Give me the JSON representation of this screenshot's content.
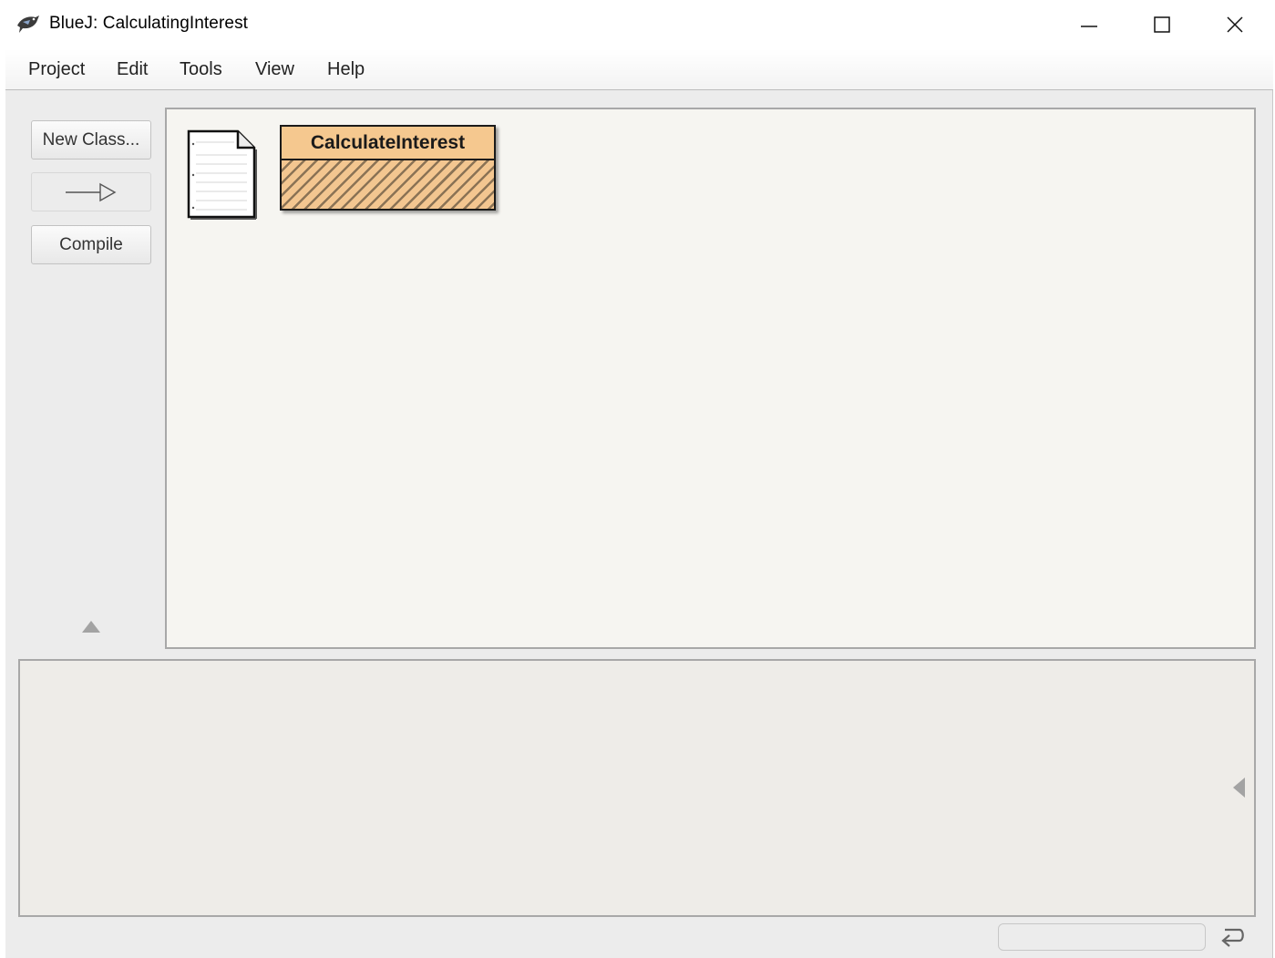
{
  "window": {
    "title": "BlueJ:  CalculatingInterest",
    "icons": {
      "app": "bluej-bird-icon",
      "minimize": "minimize-icon",
      "maximize": "maximize-icon",
      "close": "close-icon"
    }
  },
  "menu": {
    "items": [
      {
        "label": "Project"
      },
      {
        "label": "Edit"
      },
      {
        "label": "Tools"
      },
      {
        "label": "View"
      },
      {
        "label": "Help"
      }
    ]
  },
  "toolbar": {
    "new_class_label": "New Class...",
    "inheritance_arrow_icon": "inheritance-arrow-icon",
    "compile_label": "Compile",
    "collapse_icon": "triangle-up-icon"
  },
  "diagram": {
    "readme_icon": "readme-document-icon",
    "class_name": "CalculateInterest",
    "class_state": "uncompiled",
    "colors": {
      "class_fill": "#f5c88f",
      "stripe": "#8b7355",
      "canvas": "#f6f5f1"
    }
  },
  "bench": {
    "collapse_icon": "triangle-left-icon"
  },
  "status": {
    "message": "",
    "icon": "return-arrow-icon"
  }
}
